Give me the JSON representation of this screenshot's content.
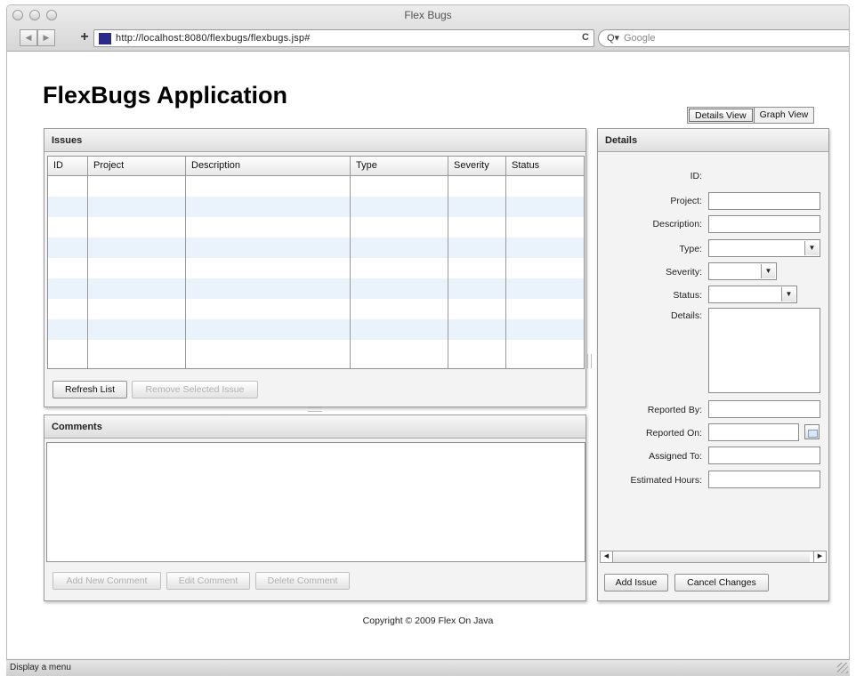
{
  "browser": {
    "window_title": "Flex Bugs",
    "url": "http://localhost:8080/flexbugs/flexbugs.jsp#",
    "search_placeholder": "Google",
    "back": "◀",
    "forward": "▶",
    "add_bookmark": "+",
    "reload": "C",
    "search_glyph": "Q▾"
  },
  "page": {
    "title": "FlexBugs Application",
    "view_toggle": {
      "details": "Details View",
      "graph": "Graph View"
    }
  },
  "issues": {
    "header": "Issues",
    "columns": [
      "ID",
      "Project",
      "Description",
      "Type",
      "Severity",
      "Status"
    ],
    "refresh_button": "Refresh List",
    "remove_button": "Remove Selected Issue"
  },
  "comments": {
    "header": "Comments",
    "add_button": "Add New Comment",
    "edit_button": "Edit Comment",
    "delete_button": "Delete Comment"
  },
  "details": {
    "header": "Details",
    "labels": {
      "id": "ID:",
      "project": "Project:",
      "description": "Description:",
      "type": "Type:",
      "severity": "Severity:",
      "status": "Status:",
      "details": "Details:",
      "reported_by": "Reported By:",
      "reported_on": "Reported On:",
      "assigned_to": "Assigned To:",
      "estimated_hours": "Estimated Hours:"
    },
    "add_issue_button": "Add Issue",
    "cancel_button": "Cancel Changes",
    "dropdown_arrow": "▼"
  },
  "footer": {
    "copyright": "Copyright © 2009 Flex On Java"
  },
  "status_bar": {
    "text": "Display a menu"
  },
  "icons": {
    "calendar": "calendar-icon",
    "favicon": "page-favicon"
  }
}
